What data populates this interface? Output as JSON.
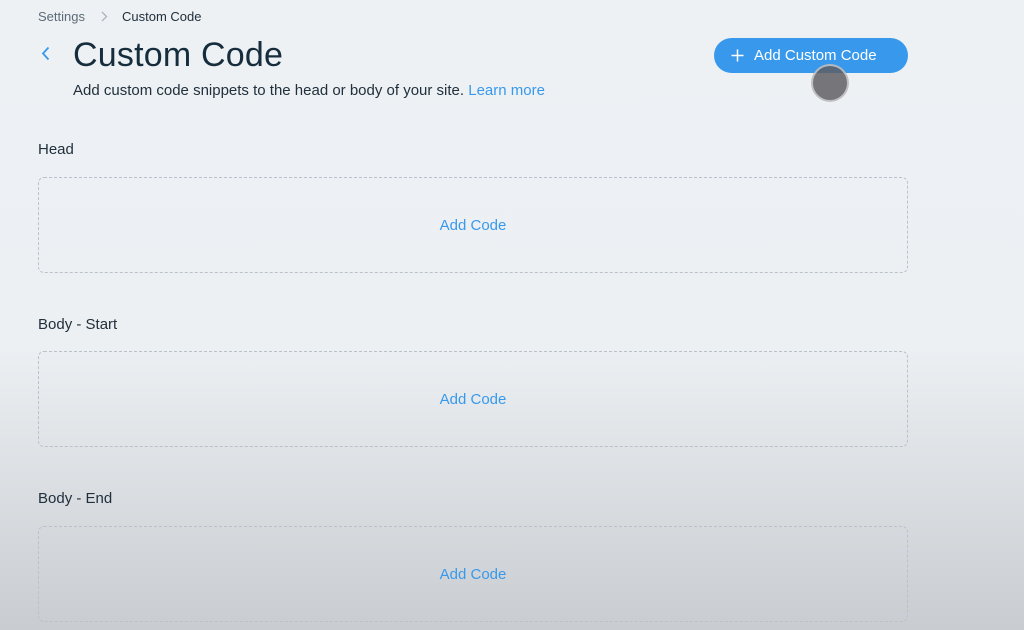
{
  "breadcrumb": {
    "root": "Settings",
    "current": "Custom Code"
  },
  "header": {
    "title": "Custom Code",
    "subtitle": "Add custom code snippets to the head or body of your site.",
    "learn_more": "Learn more",
    "add_button_label": "Add Custom Code"
  },
  "sections": [
    {
      "label": "Head",
      "action": "Add Code"
    },
    {
      "label": "Body - Start",
      "action": "Add Code"
    },
    {
      "label": "Body - End",
      "action": "Add Code"
    }
  ],
  "icons": {
    "back": "chevron-left-icon",
    "breadcrumb_separator": "chevron-right-icon",
    "add": "plus-icon"
  },
  "colors": {
    "accent": "#3899ec",
    "title": "#162d3d",
    "text": "#20303c",
    "muted": "#5c6b78",
    "dashed_border": "#b9c2ca"
  }
}
